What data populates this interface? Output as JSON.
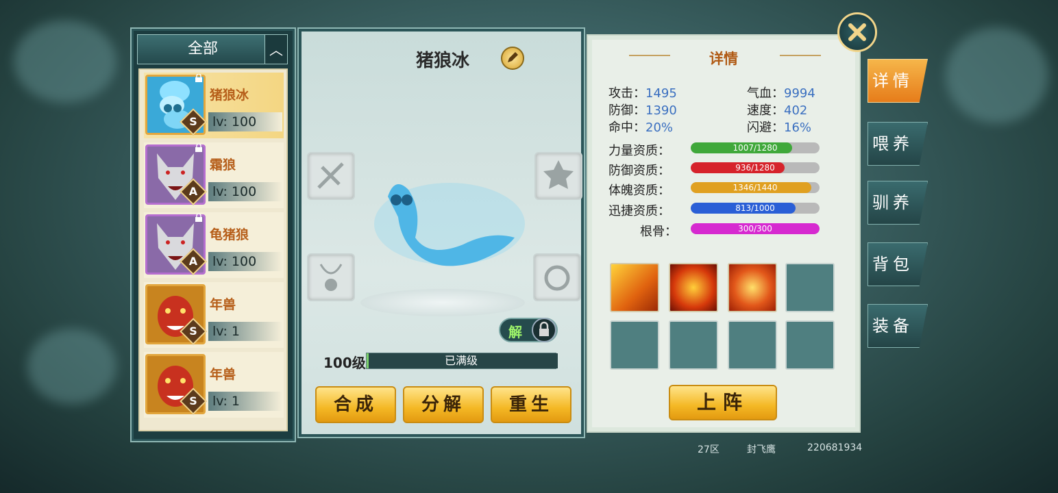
{
  "filter": {
    "label": "全部",
    "toggle_glyph": "︿"
  },
  "pets": [
    {
      "name": "猪狼冰",
      "level": "lv: 100",
      "grade": "S",
      "portrait": "ice-worm",
      "selected": true
    },
    {
      "name": "霜狼",
      "level": "lv: 100",
      "grade": "A",
      "portrait": "wolf",
      "selected": false
    },
    {
      "name": "龟猪狼",
      "level": "lv: 100",
      "grade": "A",
      "portrait": "wolf",
      "selected": false
    },
    {
      "name": "年兽",
      "level": "lv: 1",
      "grade": "S",
      "portrait": "nian-beast",
      "selected": false
    },
    {
      "name": "年兽",
      "level": "lv: 1",
      "grade": "S",
      "portrait": "nian-beast",
      "selected": false
    }
  ],
  "center": {
    "title": "猪狼冰",
    "unlock_label": "解",
    "level_label": "100级",
    "exp_text": "已满级",
    "buttons": {
      "compose": "合成",
      "decompose": "分解",
      "reborn": "重生"
    }
  },
  "detail": {
    "header": "详情",
    "stats": [
      {
        "label": "攻击：",
        "value": "1495"
      },
      {
        "label": "气血：",
        "value": "9994"
      },
      {
        "label": "防御：",
        "value": "1390"
      },
      {
        "label": "速度：",
        "value": "402"
      },
      {
        "label": "命中：",
        "value": "20%"
      },
      {
        "label": "闪避：",
        "value": "16%"
      }
    ],
    "aptitudes": [
      {
        "label": "力量资质：",
        "text": "1007/1280",
        "fraction": 0.787,
        "color": "#3fa83a"
      },
      {
        "label": "防御资质：",
        "text": "936/1280",
        "fraction": 0.731,
        "color": "#d6232b"
      },
      {
        "label": "体魄资质：",
        "text": "1346/1440",
        "fraction": 0.935,
        "color": "#e0a020"
      },
      {
        "label": "迅捷资质：",
        "text": "813/1000",
        "fraction": 0.813,
        "color": "#2a5fd6"
      },
      {
        "label": "根骨：",
        "text": "300/300",
        "fraction": 1.0,
        "color": "#d62ad0"
      }
    ],
    "deploy": "上阵"
  },
  "side_tabs": [
    "详情",
    "喂养",
    "驯养",
    "背包",
    "装备"
  ],
  "footer": {
    "server": "27区",
    "player": "封飞鹰",
    "player_id": "220681934"
  },
  "colors": {
    "accent": "#f4b825",
    "panel": "#1c3d40",
    "active_tab": "#e67c1a"
  }
}
